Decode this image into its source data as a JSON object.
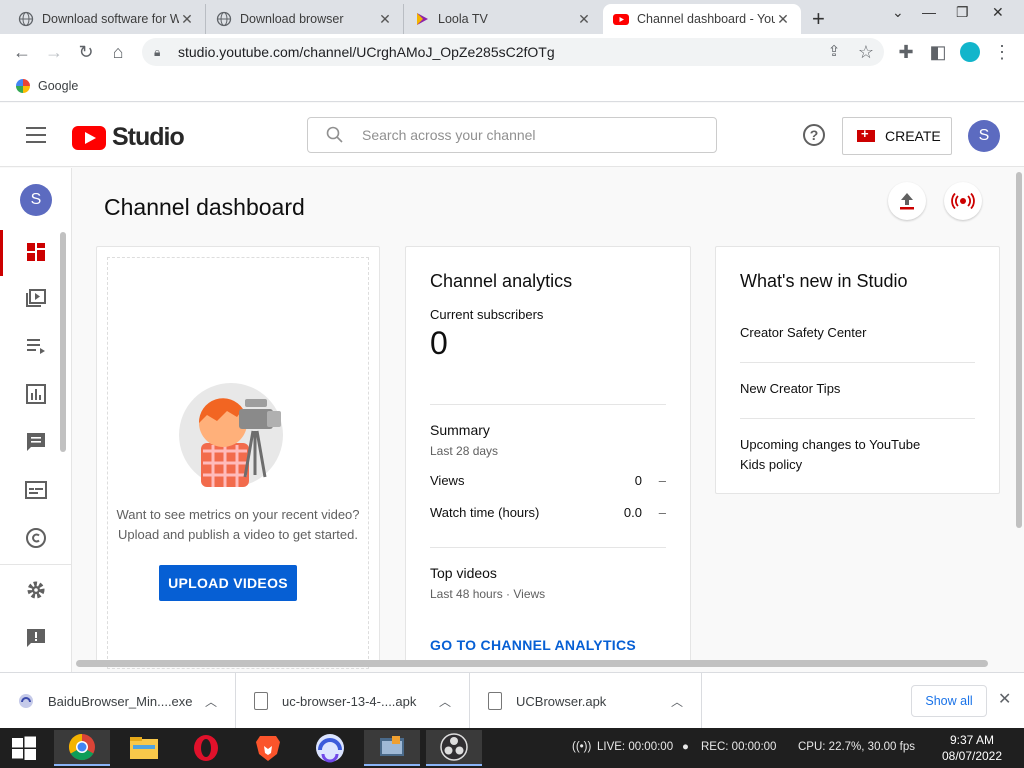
{
  "browser": {
    "tabs": [
      {
        "title": "Download software for W",
        "active": false
      },
      {
        "title": "Download browser",
        "active": false
      },
      {
        "title": "Loola TV",
        "active": false
      },
      {
        "title": "Channel dashboard - You",
        "active": true
      }
    ],
    "url": "studio.youtube.com/channel/UCrghAMoJ_OpZe285sC2fOTg",
    "bookmark": "Google"
  },
  "studio": {
    "logo_text": "Studio",
    "search_placeholder": "Search across your channel",
    "create_label": "CREATE",
    "avatar_letter": "S"
  },
  "page": {
    "title": "Channel dashboard"
  },
  "upload_card": {
    "prompt_line1": "Want to see metrics on your recent video?",
    "prompt_line2": "Upload and publish a video to get started.",
    "button_label": "UPLOAD VIDEOS"
  },
  "analytics": {
    "title": "Channel analytics",
    "subscribers_label": "Current subscribers",
    "subscribers_value": "0",
    "summary_title": "Summary",
    "summary_period": "Last 28 days",
    "rows": [
      {
        "label": "Views",
        "value": "0",
        "delta": "–"
      },
      {
        "label": "Watch time (hours)",
        "value": "0.0",
        "delta": "–"
      }
    ],
    "top_videos_title": "Top videos",
    "top_videos_period": "Last 48 hours · Views",
    "link_label": "GO TO CHANNEL ANALYTICS"
  },
  "whats_new": {
    "title": "What's new in Studio",
    "items": [
      "Creator Safety Center",
      "New Creator Tips",
      "Upcoming changes to YouTube Kids policy"
    ]
  },
  "downloads": {
    "items": [
      "BaiduBrowser_Min....exe",
      "uc-browser-13-4-....apk",
      "UCBrowser.apk"
    ],
    "show_all": "Show all"
  },
  "taskbar": {
    "live": "LIVE: 00:00:00",
    "rec": "REC: 00:00:00",
    "cpu": "CPU: 22.7%, 30.00 fps",
    "time": "9:37 AM",
    "date": "08/07/2022"
  }
}
